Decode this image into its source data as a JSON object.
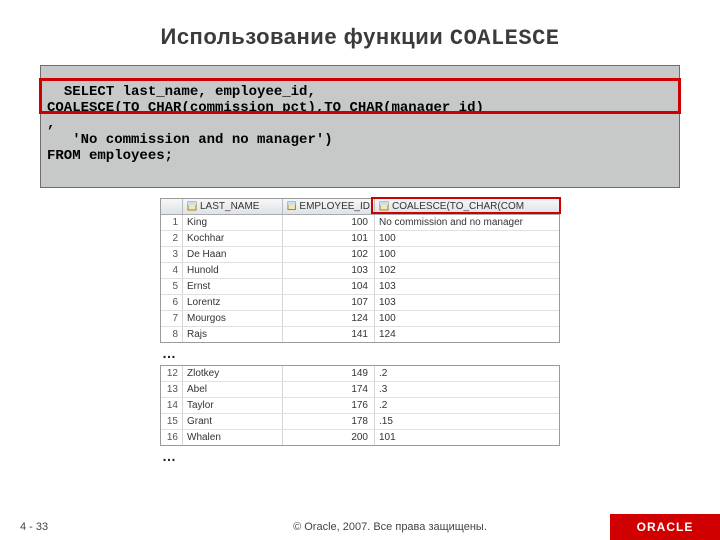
{
  "title_prefix": "Использование функции ",
  "title_func": "COALESCE",
  "sql": "SELECT last_name, employee_id,\nCOALESCE(TO_CHAR(commission_pct),TO_CHAR(manager_id)\n,\n   'No commission and no manager')\nFROM employees;",
  "headers": {
    "last_name": "LAST_NAME",
    "employee_id": "EMPLOYEE_ID",
    "coalesce": "COALESCE(TO_CHAR(COM"
  },
  "rows1": [
    {
      "n": "1",
      "ln": "King",
      "eid": "100",
      "co": "No commission and no manager"
    },
    {
      "n": "2",
      "ln": "Kochhar",
      "eid": "101",
      "co": "100"
    },
    {
      "n": "3",
      "ln": "De Haan",
      "eid": "102",
      "co": "100"
    },
    {
      "n": "4",
      "ln": "Hunold",
      "eid": "103",
      "co": "102"
    },
    {
      "n": "5",
      "ln": "Ernst",
      "eid": "104",
      "co": "103"
    },
    {
      "n": "6",
      "ln": "Lorentz",
      "eid": "107",
      "co": "103"
    },
    {
      "n": "7",
      "ln": "Mourgos",
      "eid": "124",
      "co": "100"
    },
    {
      "n": "8",
      "ln": "Rajs",
      "eid": "141",
      "co": "124"
    }
  ],
  "ellipsis": "…",
  "rows2": [
    {
      "n": "12",
      "ln": "Zlotkey",
      "eid": "149",
      "co": ".2"
    },
    {
      "n": "13",
      "ln": "Abel",
      "eid": "174",
      "co": ".3"
    },
    {
      "n": "14",
      "ln": "Taylor",
      "eid": "176",
      "co": ".2"
    },
    {
      "n": "15",
      "ln": "Grant",
      "eid": "178",
      "co": ".15"
    },
    {
      "n": "16",
      "ln": "Whalen",
      "eid": "200",
      "co": "101"
    }
  ],
  "footer": {
    "page": "4 - 33",
    "copy": "© Oracle, 2007. Все права защищены.",
    "brand": "ORACLE"
  }
}
